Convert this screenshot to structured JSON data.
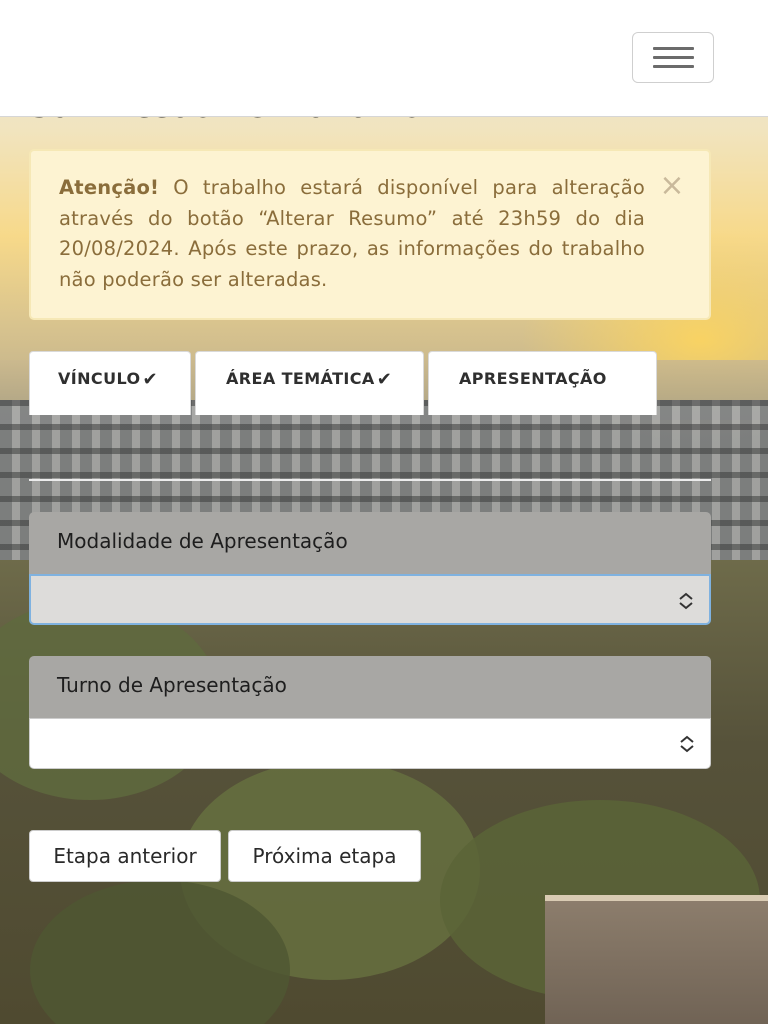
{
  "page": {
    "title": "Submissão de Trabalho"
  },
  "header": {
    "menu_icon": "hamburger-menu-icon"
  },
  "alert": {
    "title": "Atenção!",
    "message": "O trabalho estará disponível para alteração através do botão “Alterar Resumo” até 23h59 do dia 20/08/2024. Após este prazo, as informações do trabalho não poderão ser alteradas.",
    "close_symbol": "×",
    "background_color": "#fdf3d2",
    "text_color": "#8a6d3b"
  },
  "tabs": [
    {
      "label": "VÍNCULO",
      "completed": true,
      "check_symbol": "✔"
    },
    {
      "label": "ÁREA TEMÁTICA",
      "completed": true,
      "check_symbol": "✔"
    },
    {
      "label": "APRESENTAÇÃO",
      "completed": false,
      "check_symbol": ""
    }
  ],
  "form": {
    "modalidade": {
      "label": "Modalidade de Apresentação",
      "selected": "",
      "focused": true
    },
    "turno": {
      "label": "Turno de Apresentação",
      "selected": "",
      "focused": false
    }
  },
  "buttons": {
    "previous": "Etapa anterior",
    "next": "Próxima etapa"
  },
  "colors": {
    "label_bg": "#a8a7a4",
    "focus_border": "#7fb2e0"
  }
}
